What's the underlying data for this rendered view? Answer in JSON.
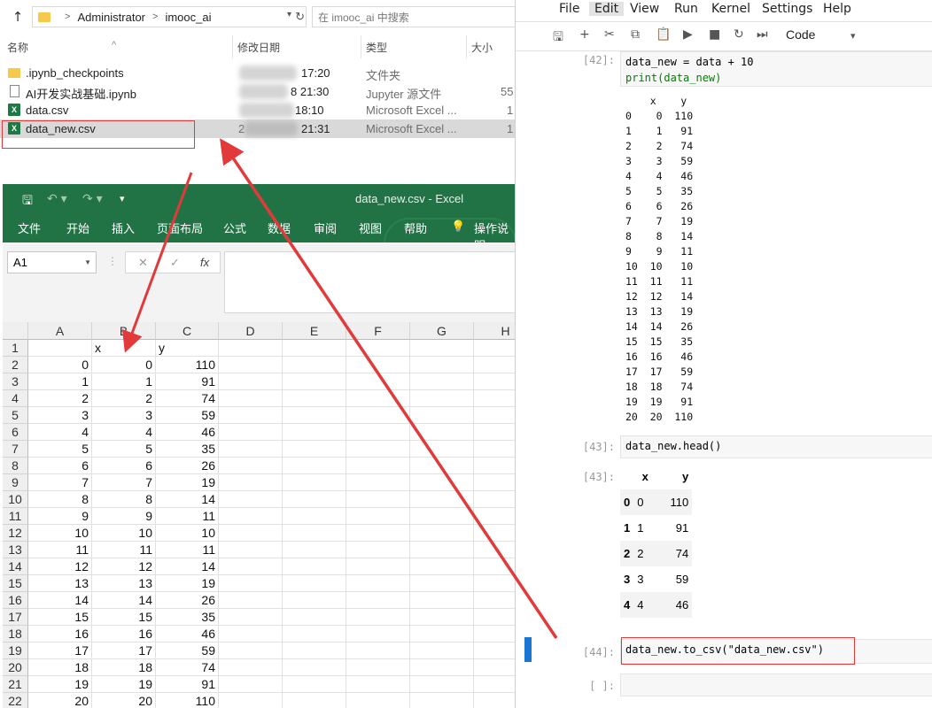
{
  "explorer": {
    "breadcrumb": [
      "Administrator",
      "imooc_ai"
    ],
    "search_placeholder": "在 imooc_ai 中搜索",
    "columns": {
      "name": "名称",
      "modified": "修改日期",
      "type": "类型",
      "size": "大小"
    },
    "files": [
      {
        "name": ".ipynb_checkpoints",
        "modified": "17:20",
        "type": "文件夹",
        "size": "",
        "icon": "folder-icon"
      },
      {
        "name": "AI开发实战基础.ipynb",
        "modified": "8 21:30",
        "type": "Jupyter 源文件",
        "size": "55",
        "icon": "notebook-file-icon"
      },
      {
        "name": "data.csv",
        "modified": "18:10",
        "type": "Microsoft Excel ...",
        "size": "1",
        "icon": "excel-file-icon"
      },
      {
        "name": "data_new.csv",
        "modified": "21:31",
        "type": "Microsoft Excel ...",
        "size": "1",
        "icon": "excel-file-icon",
        "date_prefix": "2"
      }
    ]
  },
  "excel": {
    "window_title": "data_new.csv  -  Excel",
    "ribbon_tabs": [
      "文件",
      "开始",
      "插入",
      "页面布局",
      "公式",
      "数据",
      "审阅",
      "视图",
      "帮助",
      "操作说明"
    ],
    "name_box": "A1",
    "fx_label": "fx",
    "columns": [
      "A",
      "B",
      "C",
      "D",
      "E",
      "F",
      "G",
      "H"
    ],
    "header_row": [
      "",
      "x",
      "y"
    ],
    "rows": [
      [
        0,
        0,
        110
      ],
      [
        1,
        1,
        91
      ],
      [
        2,
        2,
        74
      ],
      [
        3,
        3,
        59
      ],
      [
        4,
        4,
        46
      ],
      [
        5,
        5,
        35
      ],
      [
        6,
        6,
        26
      ],
      [
        7,
        7,
        19
      ],
      [
        8,
        8,
        14
      ],
      [
        9,
        9,
        11
      ],
      [
        10,
        10,
        10
      ],
      [
        11,
        11,
        11
      ],
      [
        12,
        12,
        14
      ],
      [
        13,
        13,
        19
      ],
      [
        14,
        14,
        26
      ],
      [
        15,
        15,
        35
      ],
      [
        16,
        16,
        46
      ],
      [
        17,
        17,
        59
      ],
      [
        18,
        18,
        74
      ],
      [
        19,
        19,
        91
      ],
      [
        20,
        20,
        110
      ]
    ]
  },
  "jupyter": {
    "menu": [
      "File",
      "Edit",
      "View",
      "Run",
      "Kernel",
      "Settings",
      "Help"
    ],
    "active_menu": "Edit",
    "cell_type": "Code",
    "cells": [
      {
        "prompt": "[42]:",
        "code_line1": "data_new = data + 10",
        "code_line2": "print(data_new)"
      },
      {
        "prompt": "[43]:",
        "code": "data_new.head()",
        "out_prompt": "[43]:"
      },
      {
        "prompt": "[44]:",
        "code": "data_new.to_csv(\"data_new.csv\")"
      },
      {
        "prompt": "[ ]:",
        "code": ""
      }
    ],
    "print_output": {
      "header": "    x    y",
      "rows": [
        "0    0  110",
        "1    1   91",
        "2    2   74",
        "3    3   59",
        "4    4   46",
        "5    5   35",
        "6    6   26",
        "7    7   19",
        "8    8   14",
        "9    9   11",
        "10  10   10",
        "11  11   11",
        "12  12   14",
        "13  13   19",
        "14  14   26",
        "15  15   35",
        "16  16   46",
        "17  17   59",
        "18  18   74",
        "19  19   91",
        "20  20  110"
      ]
    },
    "head_table": {
      "columns": [
        "x",
        "y"
      ],
      "rows": [
        {
          "index": "0",
          "x": "0",
          "y": "110"
        },
        {
          "index": "1",
          "x": "1",
          "y": "91"
        },
        {
          "index": "2",
          "x": "2",
          "y": "74"
        },
        {
          "index": "3",
          "x": "3",
          "y": "59"
        },
        {
          "index": "4",
          "x": "4",
          "y": "46"
        }
      ]
    }
  },
  "colors": {
    "excel_green": "#217346",
    "annotation_red": "#e23a3a",
    "jupyter_active": "#1976d2"
  }
}
